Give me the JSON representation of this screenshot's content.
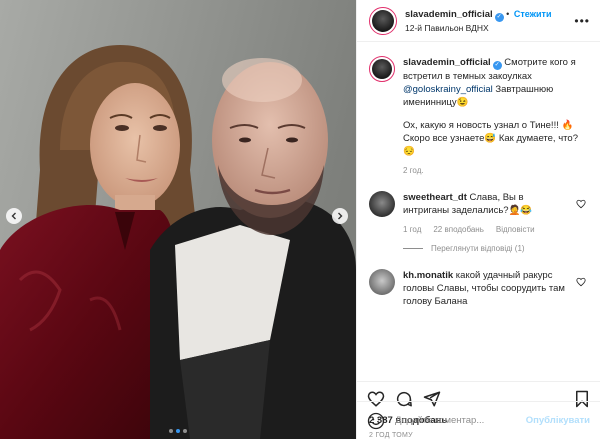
{
  "header": {
    "username": "slavademin_official",
    "follow_label": "Стежити",
    "location": "12-й Павильон ВДНХ"
  },
  "caption": {
    "username": "slavademin_official",
    "mention": "@goloskrainy_official",
    "text_before": "Смотрите кого я встретил в темных закоулках",
    "text_after": "Завтрашнюю именинницу😉",
    "text2": "Ох, какую я новость узнал о Тине!!! 🔥 Скоро все узнаете😅 Как думаете, что?😔",
    "time": "2 год."
  },
  "comments": [
    {
      "username": "sweetheart_dt",
      "text": "Слава, Вы в интриганы заделались?🤦😂",
      "time": "1 год",
      "likes": "22 вподобань",
      "reply": "Відповісти",
      "view_replies": "Переглянути відповіді (1)"
    },
    {
      "username": "kh.monatik",
      "text": "какой удачный ракурс головы Славы, чтобы соорудить там голову Балана"
    }
  ],
  "likes_count": "2 387 вподобань",
  "time_ago": "2 ГОД ТОМУ",
  "add_comment": {
    "placeholder": "Додайте коментар...",
    "publish": "Опублікувати"
  },
  "icons": [
    "heart-icon",
    "comment-icon",
    "share-icon",
    "bookmark-icon",
    "emoji-icon",
    "more-icon",
    "verified-icon"
  ],
  "colors": {
    "accent": "#0095f6",
    "verified": "#3897f0",
    "muted": "#8e8e8e"
  }
}
